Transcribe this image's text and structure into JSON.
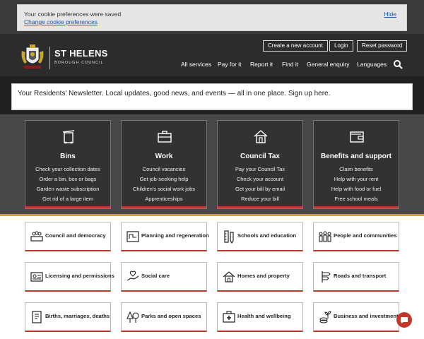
{
  "cookie": {
    "message": "Your cookie preferences were saved",
    "change_link": "Change cookie preferences",
    "hide_link": "Hide"
  },
  "header": {
    "brand_title": "ST HELENS",
    "brand_subtitle": "BOROUGH COUNCIL",
    "account_buttons": [
      "Create a new account",
      "Login",
      "Reset password"
    ],
    "nav": [
      "All services",
      "Pay for it",
      "Report it",
      "Find it",
      "General enquiry",
      "Languages"
    ]
  },
  "banner": {
    "text": "Your Residents' Newsletter. Local updates, good news, and events — all in one place. Sign up here."
  },
  "tiles": [
    {
      "title": "Bins",
      "icon": "bin-icon",
      "links": [
        "Check your collection dates",
        "Order a bin, box or bags",
        "Garden waste subscription",
        "Get rid of a large item"
      ]
    },
    {
      "title": "Work",
      "icon": "briefcase-icon",
      "links": [
        "Council vacancies",
        "Get job-seeking help",
        "Children's social work jobs",
        "Apprenticeships"
      ]
    },
    {
      "title": "Council Tax",
      "icon": "house-icon",
      "links": [
        "Pay your Council Tax",
        "Check your account",
        "Get your bill by email",
        "Reduce your bill"
      ]
    },
    {
      "title": "Benefits and support",
      "icon": "wallet-icon",
      "links": [
        "Claim benefits",
        "Help with your rent",
        "Help with food or fuel",
        "Free school meals"
      ]
    }
  ],
  "services": [
    {
      "label": "Council and democracy",
      "icon": "council-chamber-icon"
    },
    {
      "label": "Planning and regeneration",
      "icon": "blueprint-icon"
    },
    {
      "label": "Schools and education",
      "icon": "ruler-pencil-icon"
    },
    {
      "label": "People and communities",
      "icon": "people-group-icon"
    },
    {
      "label": "Licensing and permissions",
      "icon": "licence-card-icon"
    },
    {
      "label": "Social care",
      "icon": "caring-hand-icon"
    },
    {
      "label": "Homes and property",
      "icon": "home-icon"
    },
    {
      "label": "Roads and transport",
      "icon": "road-sign-icon"
    },
    {
      "label": "Births, marriages, deaths",
      "icon": "certificate-icon"
    },
    {
      "label": "Parks and open spaces",
      "icon": "trees-icon"
    },
    {
      "label": "Health and wellbeing",
      "icon": "first-aid-icon"
    },
    {
      "label": "Business and investment",
      "icon": "money-plant-icon"
    }
  ],
  "colors": {
    "header_bg": "#2c2c2c",
    "tiles_bg": "#484848",
    "accent_red": "#c0392b",
    "accent_gold": "#c8a82c",
    "link_blue": "#1a56b0"
  }
}
